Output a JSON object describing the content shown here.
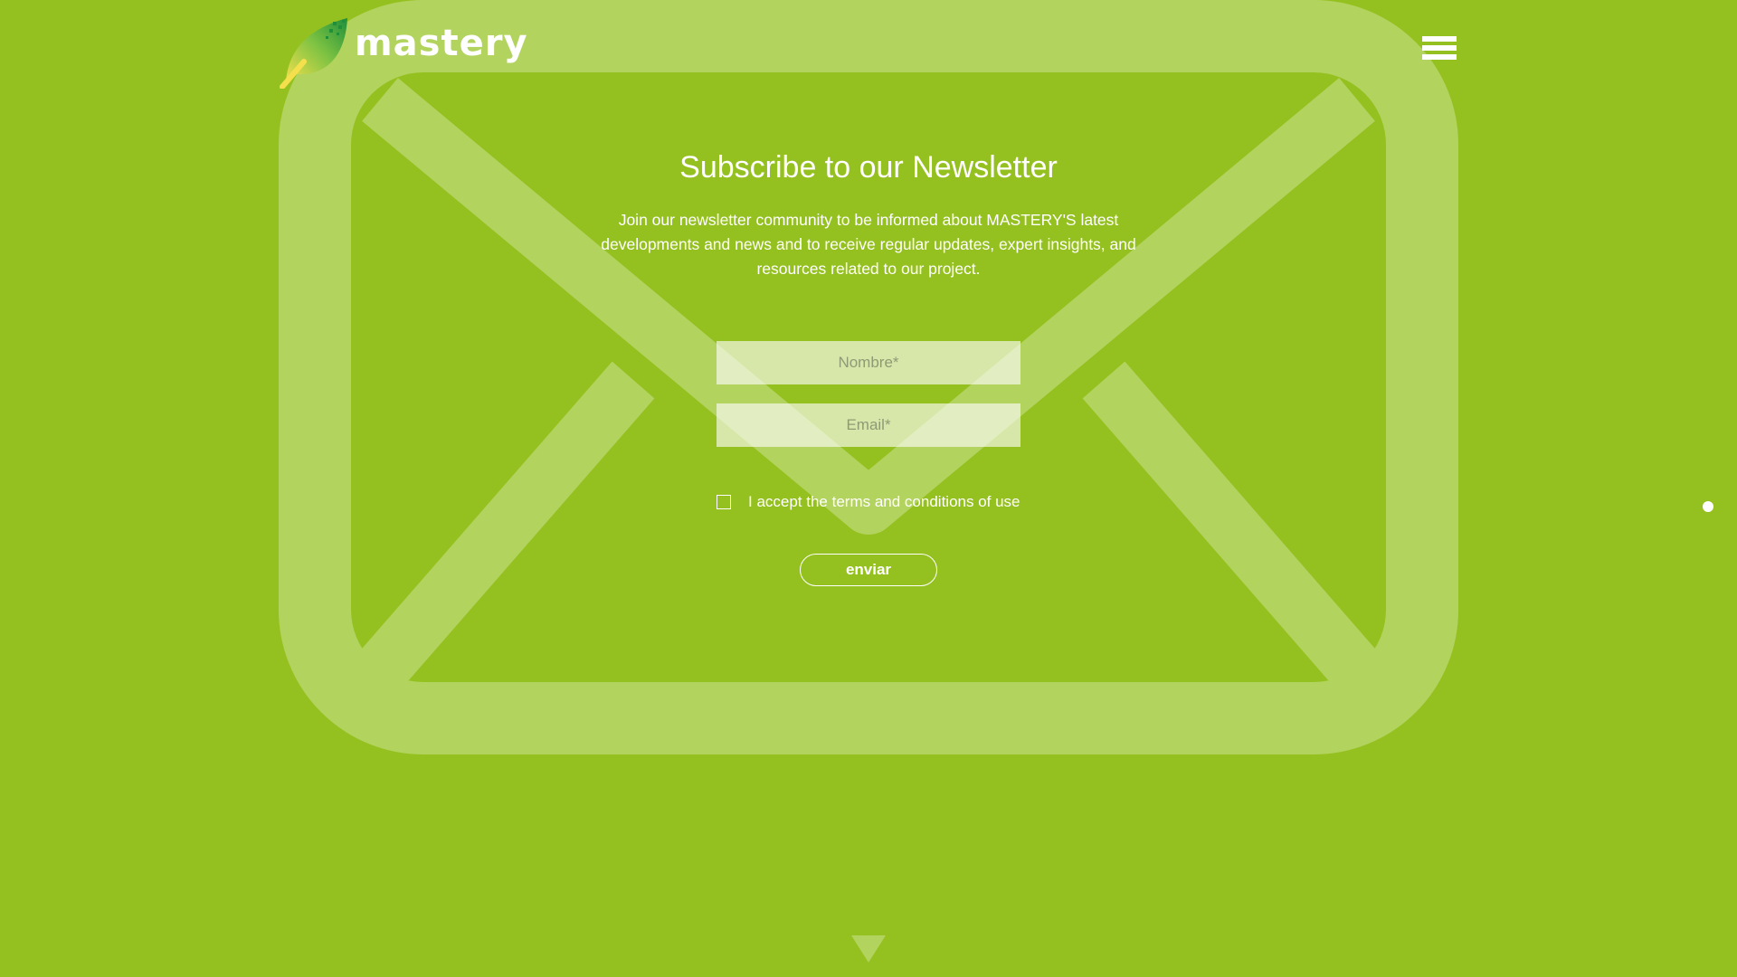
{
  "brand": {
    "name": "mastery",
    "logo_icon": "leaf-logo-icon"
  },
  "header": {
    "menu_icon": "hamburger-menu-icon"
  },
  "newsletter": {
    "title": "Subscribe to our Newsletter",
    "description": "Join our newsletter community to be informed about MASTERY'S latest developments and news and to receive regular updates, expert insights, and resources related to our project.",
    "name_placeholder": "Nombre*",
    "name_value": "",
    "email_placeholder": "Email*",
    "email_value": "",
    "terms_label": "I accept the terms and conditions of use",
    "terms_checked": false,
    "submit_label": "enviar"
  },
  "navigation": {
    "side_dot_icon": "section-dot-icon",
    "scroll_icon": "scroll-down-arrow-icon"
  },
  "colors": {
    "background": "#95c120",
    "envelope_overlay": "#b3d35f",
    "text": "#ffffff"
  }
}
